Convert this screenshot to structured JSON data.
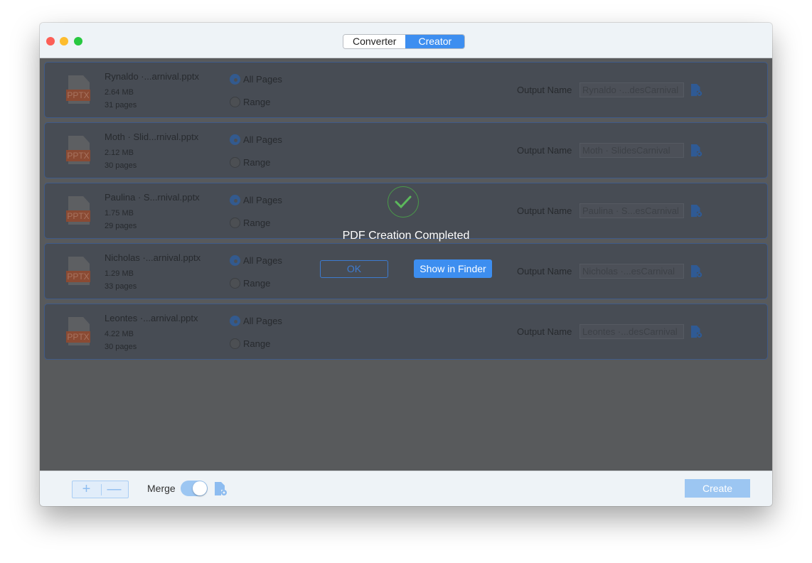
{
  "tabs": {
    "converter": "Converter",
    "creator": "Creator"
  },
  "files": [
    {
      "name": "Rynaldo ·...arnival.pptx",
      "size": "2.64 MB",
      "pages": "31 pages",
      "output": "Rynaldo ·...desCarnival"
    },
    {
      "name": "Moth · Slid...rnival.pptx",
      "size": "2.12 MB",
      "pages": "30 pages",
      "output": "Moth · SlidesCarnival"
    },
    {
      "name": "Paulina · S...rnival.pptx",
      "size": "1.75 MB",
      "pages": "29 pages",
      "output": "Paulina · S...esCarnival"
    },
    {
      "name": "Nicholas ·...arnival.pptx",
      "size": "1.29 MB",
      "pages": "33 pages",
      "output": "Nicholas ·...esCarnival"
    },
    {
      "name": "Leontes ·...arnival.pptx",
      "size": "4.22 MB",
      "pages": "30 pages",
      "output": "Leontes ·...desCarnival"
    }
  ],
  "labels": {
    "file_type": "PPTX",
    "all_pages": "All Pages",
    "range": "Range",
    "output_name": "Output Name"
  },
  "dialog": {
    "title": "PDF Creation Completed",
    "ok": "OK",
    "show_in_finder": "Show in Finder"
  },
  "footer": {
    "add": "+",
    "remove": "—",
    "merge": "Merge",
    "merge_on": true,
    "create": "Create"
  },
  "colors": {
    "accent": "#3d8ef0",
    "success": "#4a9a4a"
  }
}
